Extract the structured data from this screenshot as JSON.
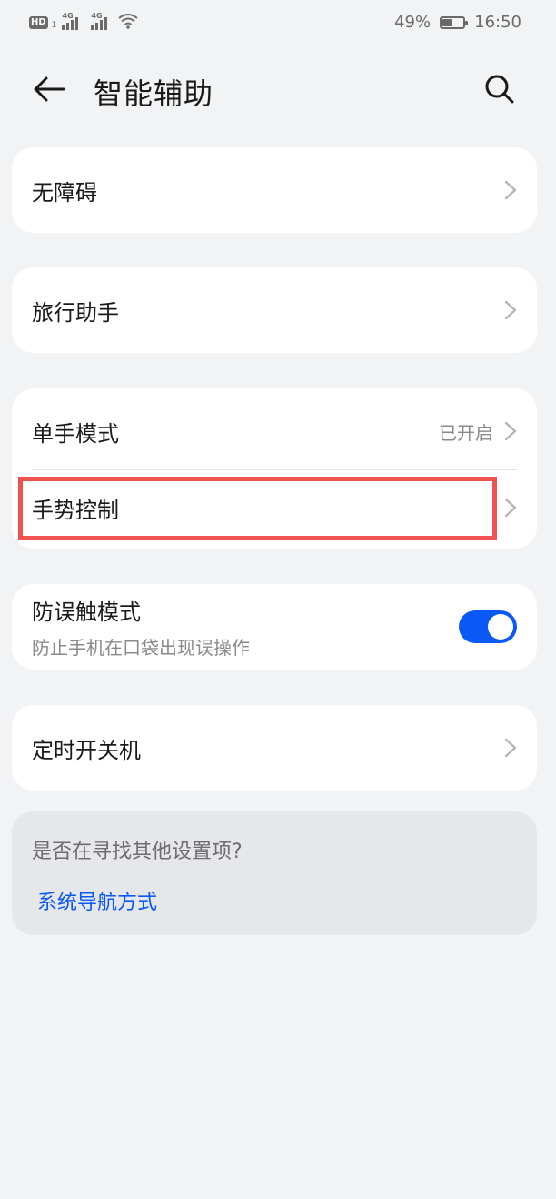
{
  "status_bar": {
    "hd_label": "HD",
    "sim_number": "1",
    "network_1": "4G",
    "network_2": "4G",
    "battery_text": "49%",
    "battery_level": 0.49,
    "time": "16:50"
  },
  "header": {
    "title": "智能辅助"
  },
  "items": {
    "accessibility": {
      "label": "无障碍"
    },
    "travel_assistant": {
      "label": "旅行助手"
    },
    "one_hand_mode": {
      "label": "单手模式",
      "value": "已开启"
    },
    "gesture_control": {
      "label": "手势控制"
    },
    "accidental_touch": {
      "label": "防误触模式",
      "description": "防止手机在口袋出现误操作",
      "enabled": true
    },
    "scheduled_power": {
      "label": "定时开关机"
    }
  },
  "suggestion": {
    "title": "是否在寻找其他设置项?",
    "link": "系统导航方式"
  },
  "colors": {
    "background": "#f1f3f5",
    "accent": "#0a59f7",
    "highlight": "#ef5350"
  }
}
